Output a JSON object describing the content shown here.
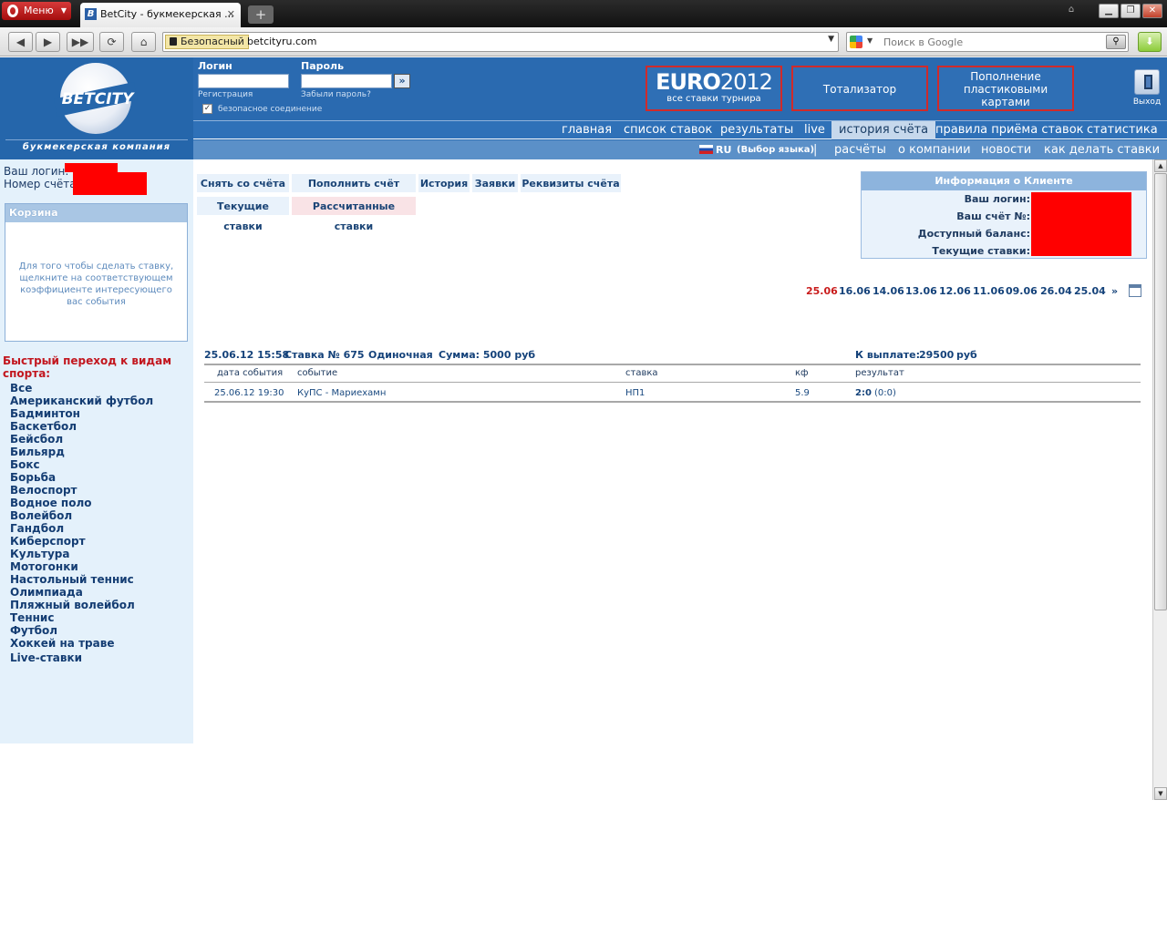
{
  "browser": {
    "menu_label": "Меню",
    "tab_title": "BetCity - букмекерская ...",
    "address_security": "Безопасный",
    "url": "betcityru.com",
    "search_placeholder": "Поиск в Google"
  },
  "header": {
    "logo_text": "BETCITY",
    "logo_subtitle": "букмекерская компания",
    "login_label": "Логин",
    "password_label": "Пароль",
    "register_link": "Регистрация",
    "forgot_link": "Забыли пароль?",
    "secure_conn_label": "безопасное соединение",
    "promo_euro_title_main": "EURO",
    "promo_euro_title_year": "2012",
    "promo_euro_sub": "все ставки турнира",
    "promo_totalizator": "Тотализатор",
    "promo_cards": "Пополнение пластиковыми картами",
    "exit_label": "Выход",
    "menu_primary": [
      "главная",
      "список ставок",
      "результаты",
      "live",
      "история счёта",
      "правила приёма ставок",
      "статистика"
    ],
    "lang_label": "RU",
    "lang_choice": "(Выбор языка)",
    "separator": "|",
    "menu_secondary": [
      "расчёты",
      "о компании",
      "новости",
      "как делать ставки"
    ]
  },
  "left": {
    "login_label": "Ваш логин:",
    "account_label": "Номер счёта:",
    "cart_title": "Корзина",
    "cart_text": "Для того чтобы сделать ставку, щелкните на соответствующем коэффициенте интересующего вас события",
    "quick_title": "Быстрый переход к видам спорта:",
    "sports": [
      "Все",
      "Американский футбол",
      "Бадминтон",
      "Баскетбол",
      "Бейсбол",
      "Бильярд",
      "Бокс",
      "Борьба",
      "Велоспорт",
      "Водное поло",
      "Волейбол",
      "Гандбол",
      "Киберспорт",
      "Культура",
      "Мотогонки",
      "Настольный теннис",
      "Олимпиада",
      "Пляжный волейбол",
      "Теннис",
      "Футбол",
      "Хоккей на траве"
    ],
    "live_bets": "Live-ставки"
  },
  "main": {
    "tabs_row1": [
      "Снять со счёта",
      "Пополнить счёт",
      "История",
      "Заявки",
      "Реквизиты счёта"
    ],
    "tabs_row2": [
      "Текущие ставки",
      "Рассчитанные ставки"
    ],
    "client_title": "Информация о Клиенте",
    "client_fields": [
      "Ваш логин:",
      "Ваш счёт №:",
      "Доступный баланс:",
      "Текущие ставки:"
    ],
    "dates": [
      "25.06",
      "16.06",
      "14.06",
      "13.06",
      "12.06",
      "11.06",
      "09.06",
      "26.04",
      "25.04"
    ],
    "dates_next": "»",
    "bet": {
      "datetime": "25.06.12 15:58",
      "number": "Ставка № 675",
      "type": "Одиночная",
      "sum": "Сумма: 5000 руб",
      "payout_label": "К выплате:",
      "payout_value": "29500",
      "payout_currency": "руб"
    },
    "table_headers": [
      "дата события",
      "событие",
      "ставка",
      "кф",
      "результат"
    ],
    "row": {
      "date": "25.06.12 19:30",
      "event": "КуПС - Мариехамн",
      "bet": "НП1",
      "coef": "5.9",
      "result": "2:0",
      "result_half": "(0:0)"
    }
  },
  "colors": {
    "header_blue": "#2a6ab0",
    "sidebar_bg": "#e4f1fb",
    "accent_red": "#c2161e",
    "link_blue": "#14427a"
  }
}
